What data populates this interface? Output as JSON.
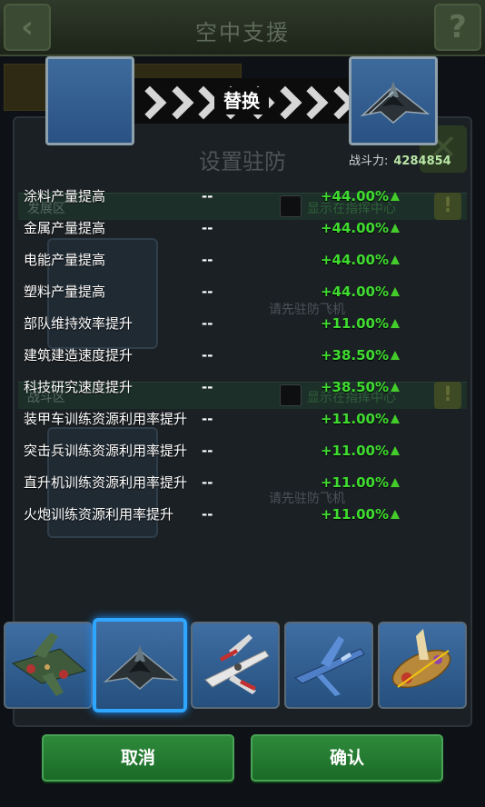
{
  "background": {
    "title": "空中支援",
    "panel_title": "设置驻防",
    "sections": [
      {
        "label": "发展区",
        "check_label": "显示在指挥中心",
        "slot_hint": "请先驻防飞机"
      },
      {
        "label": "战斗区",
        "check_label": "显示在指挥中心",
        "slot_hint": "请先驻防飞机"
      }
    ]
  },
  "swap": {
    "label": "替换",
    "power_label": "战斗力:",
    "power_value": "4284854"
  },
  "stats": [
    {
      "name": "涂料产量提高",
      "current": "--",
      "new": "+44.00%"
    },
    {
      "name": "金属产量提高",
      "current": "--",
      "new": "+44.00%"
    },
    {
      "name": "电能产量提高",
      "current": "--",
      "new": "+44.00%"
    },
    {
      "name": "塑料产量提高",
      "current": "--",
      "new": "+44.00%"
    },
    {
      "name": "部队维持效率提升",
      "current": "--",
      "new": "+11.00%"
    },
    {
      "name": "建筑建造速度提升",
      "current": "--",
      "new": "+38.50%"
    },
    {
      "name": "科技研究速度提升",
      "current": "--",
      "new": "+38.50%"
    },
    {
      "name": "装甲车训练资源利用率提升",
      "current": "--",
      "new": "+11.00%"
    },
    {
      "name": "突击兵训练资源利用率提升",
      "current": "--",
      "new": "+11.00%"
    },
    {
      "name": "直升机训练资源利用率提升",
      "current": "--",
      "new": "+11.00%"
    },
    {
      "name": "火炮训练资源利用率提升",
      "current": "--",
      "new": "+11.00%"
    }
  ],
  "planes": [
    {
      "icon": "green-bomber-plane-icon"
    },
    {
      "icon": "stealth-bomber-plane-icon",
      "selected": true
    },
    {
      "icon": "x-wing-fighter-plane-icon"
    },
    {
      "icon": "blue-jet-fighter-plane-icon"
    },
    {
      "icon": "ornate-golden-airship-icon"
    }
  ],
  "buttons": {
    "cancel": "取消",
    "confirm": "确认"
  }
}
